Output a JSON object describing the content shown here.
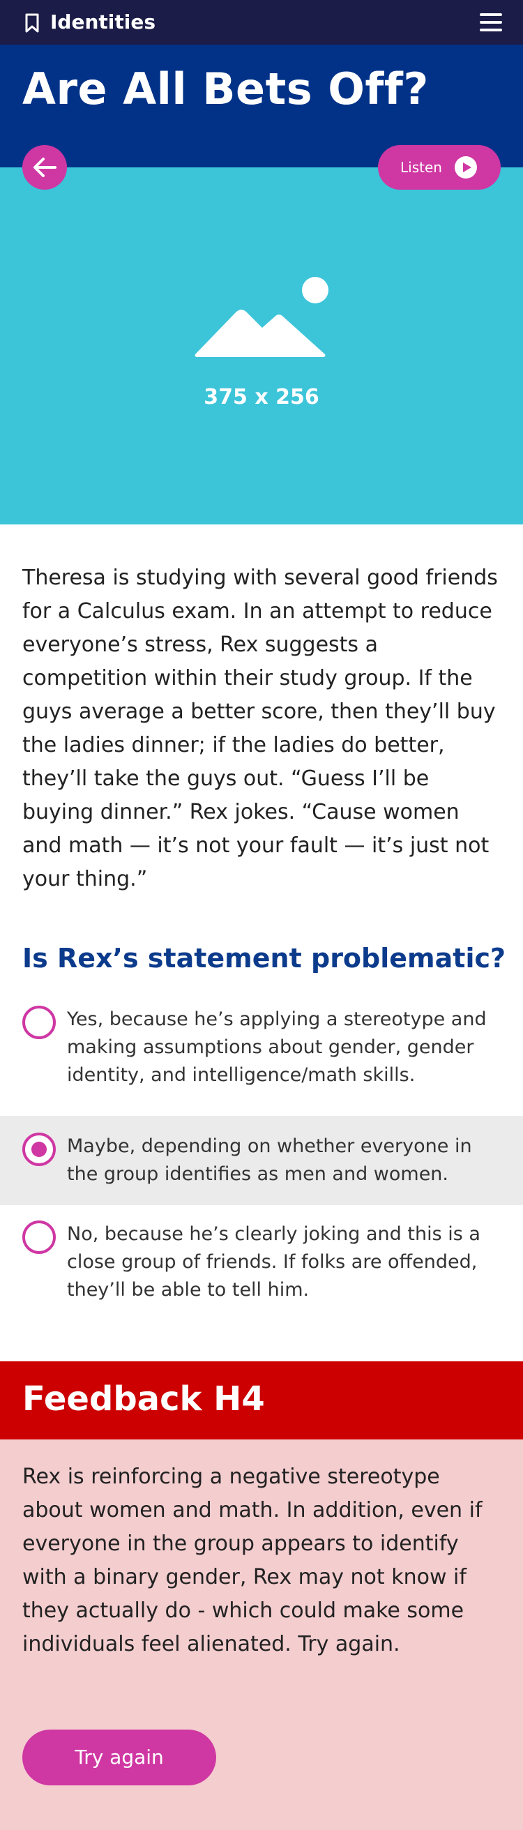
{
  "header": {
    "app_title": "Identities",
    "bookmark_icon": "bookmark-icon",
    "menu_icon": "hamburger-menu-icon"
  },
  "hero": {
    "title": "Are All Bets Off?",
    "back_icon": "arrow-left-icon",
    "listen_label": "Listen",
    "play_icon": "play-circle-icon"
  },
  "media": {
    "placeholder_icon": "image-placeholder-icon",
    "placeholder_label": "375 x 256"
  },
  "story": {
    "text": "Theresa is studying with several good friends for a Calculus exam. In an attempt to reduce everyone’s stress, Rex suggests a competition within their study group. If the guys average a better score, then they’ll buy the ladies dinner; if the ladies do better, they’ll take the guys out. “Guess I’ll be buying dinner.” Rex jokes. “Cause women and math — it’s not your fault — it’s just not your thing.”"
  },
  "quiz": {
    "question": "Is Rex’s statement problematic?",
    "options": [
      {
        "label": "Yes, because he’s applying a stereotype and making assumptions about gender, gender identity, and intelligence/math skills.",
        "selected": false
      },
      {
        "label": "Maybe, depending on whether everyone in the group identifies as men and women.",
        "selected": true
      },
      {
        "label": "No, because he’s clearly joking and this is a close group of friends. If folks are offended, they’ll be able to tell him.",
        "selected": false
      }
    ]
  },
  "feedback": {
    "title": "Feedback H4",
    "text": "Rex is reinforcing a negative stereotype about women and math. In addition, even if everyone in the group appears to identify with a binary gender, Rex may not know if they actually do - which could make some individuals feel alienated. Try again.",
    "button_label": "Try again"
  },
  "colors": {
    "topbar": "#1c1c48",
    "hero": "#023288",
    "media": "#3cc4d9",
    "accent": "#cf37a3",
    "question": "#0c3b8c",
    "feedback_head": "#cc0000",
    "feedback_body": "#f4cdcf",
    "selected_bg": "#ebebeb"
  }
}
